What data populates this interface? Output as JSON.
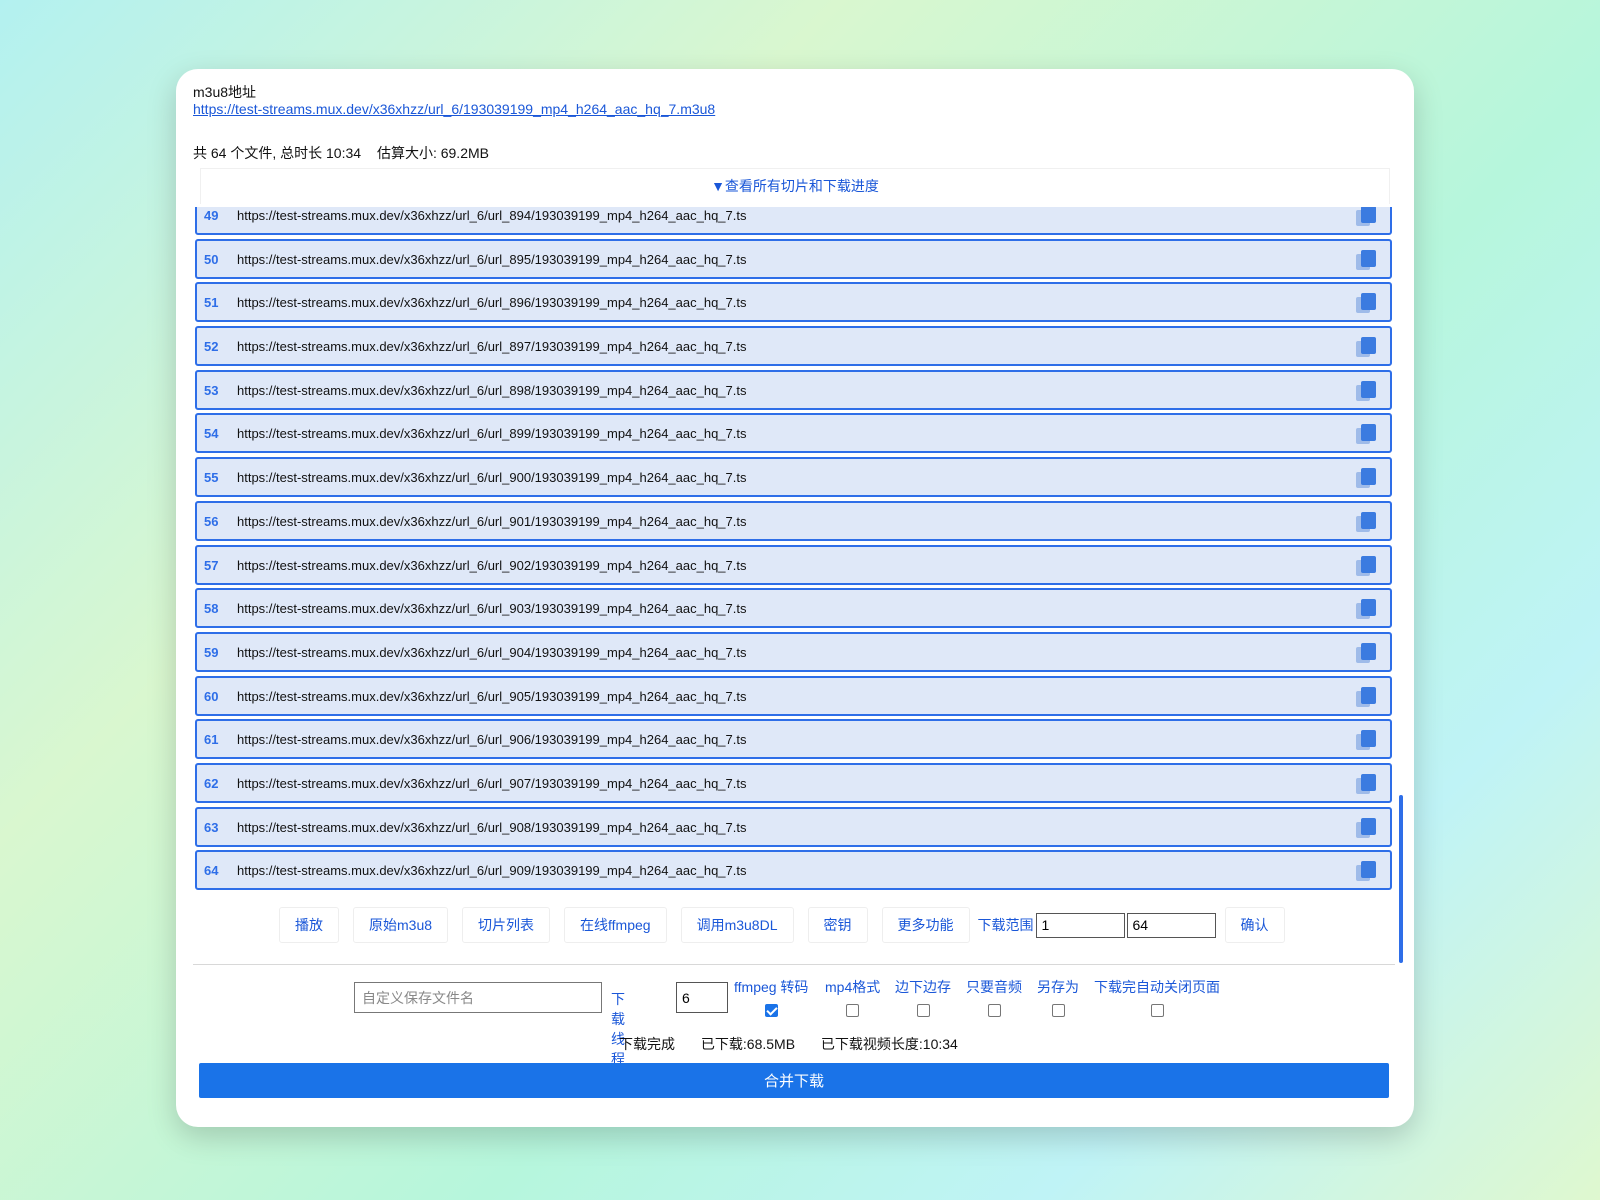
{
  "header": {
    "address_label": "m3u8地址",
    "address_url": "https://test-streams.mux.dev/x36xhzz/url_6/193039199_mp4_h264_aac_hq_7.m3u8",
    "summary_files": "共 64 个文件, 总时长 10:34",
    "summary_size": "估算大小: 69.2MB",
    "toggle_label": "▼查看所有切片和下载进度"
  },
  "segments": [
    {
      "num": "49",
      "url": "https://test-streams.mux.dev/x36xhzz/url_6/url_894/193039199_mp4_h264_aac_hq_7.ts"
    },
    {
      "num": "50",
      "url": "https://test-streams.mux.dev/x36xhzz/url_6/url_895/193039199_mp4_h264_aac_hq_7.ts"
    },
    {
      "num": "51",
      "url": "https://test-streams.mux.dev/x36xhzz/url_6/url_896/193039199_mp4_h264_aac_hq_7.ts"
    },
    {
      "num": "52",
      "url": "https://test-streams.mux.dev/x36xhzz/url_6/url_897/193039199_mp4_h264_aac_hq_7.ts"
    },
    {
      "num": "53",
      "url": "https://test-streams.mux.dev/x36xhzz/url_6/url_898/193039199_mp4_h264_aac_hq_7.ts"
    },
    {
      "num": "54",
      "url": "https://test-streams.mux.dev/x36xhzz/url_6/url_899/193039199_mp4_h264_aac_hq_7.ts"
    },
    {
      "num": "55",
      "url": "https://test-streams.mux.dev/x36xhzz/url_6/url_900/193039199_mp4_h264_aac_hq_7.ts"
    },
    {
      "num": "56",
      "url": "https://test-streams.mux.dev/x36xhzz/url_6/url_901/193039199_mp4_h264_aac_hq_7.ts"
    },
    {
      "num": "57",
      "url": "https://test-streams.mux.dev/x36xhzz/url_6/url_902/193039199_mp4_h264_aac_hq_7.ts"
    },
    {
      "num": "58",
      "url": "https://test-streams.mux.dev/x36xhzz/url_6/url_903/193039199_mp4_h264_aac_hq_7.ts"
    },
    {
      "num": "59",
      "url": "https://test-streams.mux.dev/x36xhzz/url_6/url_904/193039199_mp4_h264_aac_hq_7.ts"
    },
    {
      "num": "60",
      "url": "https://test-streams.mux.dev/x36xhzz/url_6/url_905/193039199_mp4_h264_aac_hq_7.ts"
    },
    {
      "num": "61",
      "url": "https://test-streams.mux.dev/x36xhzz/url_6/url_906/193039199_mp4_h264_aac_hq_7.ts"
    },
    {
      "num": "62",
      "url": "https://test-streams.mux.dev/x36xhzz/url_6/url_907/193039199_mp4_h264_aac_hq_7.ts"
    },
    {
      "num": "63",
      "url": "https://test-streams.mux.dev/x36xhzz/url_6/url_908/193039199_mp4_h264_aac_hq_7.ts"
    },
    {
      "num": "64",
      "url": "https://test-streams.mux.dev/x36xhzz/url_6/url_909/193039199_mp4_h264_aac_hq_7.ts"
    }
  ],
  "segment_icon": "copy-icon",
  "toolbar": {
    "play": "播放",
    "raw_m3u8": "原始m3u8",
    "segment_list": "切片列表",
    "online_ffmpeg": "在线ffmpeg",
    "call_m3u8dl": "调用m3u8DL",
    "key": "密钥",
    "more": "更多功能",
    "range_label": "下载范围",
    "range_start": "1",
    "range_end": "64",
    "confirm": "确认"
  },
  "options": {
    "filename_placeholder": "自定义保存文件名",
    "threads_label": "下载线程",
    "threads_value": "6",
    "ffmpeg_label": "ffmpeg 转码",
    "ffmpeg_checked": true,
    "mp4_label": "mp4格式",
    "mp4_checked": false,
    "stream_save_label": "边下边存",
    "stream_save_checked": false,
    "audio_only_label": "只要音频",
    "audio_only_checked": false,
    "save_as_label": "另存为",
    "save_as_checked": false,
    "auto_close_label": "下载完自动关闭页面",
    "auto_close_checked": false
  },
  "status": {
    "state": "下载完成",
    "downloaded": "已下载:68.5MB",
    "video_length": "已下载视频长度:10:34"
  },
  "merge_button": "合并下载",
  "colors": {
    "accent": "#1a73e8",
    "link": "#1a57d8",
    "row_bg": "#dfe8f8",
    "row_border": "#2e6ee8"
  }
}
